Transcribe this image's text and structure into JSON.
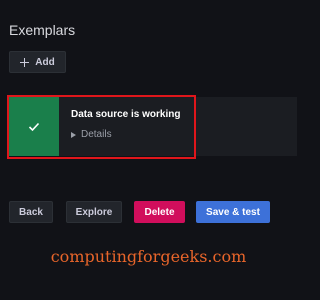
{
  "exemplars": {
    "title": "Exemplars",
    "add_button": {
      "icon": "plus-icon",
      "label": "Add"
    }
  },
  "status_alert": {
    "message": "Data source is working",
    "details_label": "Details",
    "status_icon": "check-icon",
    "status_color": "#1a7f4b"
  },
  "actions": {
    "back_label": "Back",
    "explore_label": "Explore",
    "delete_label": "Delete",
    "save_test_label": "Save & test"
  },
  "watermark": "computingforgeeks.com"
}
